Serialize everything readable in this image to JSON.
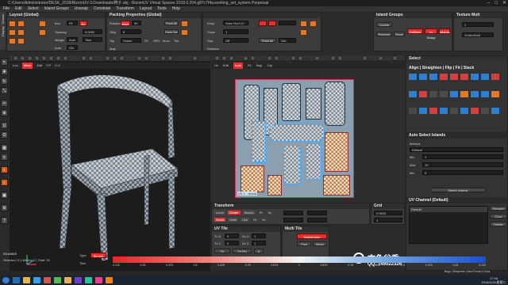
{
  "window": {
    "title": "C:/Users/Administrator/DESK_2018/RizomUV-3.Downloads/椅子.obj - RizomUV Virtual Spaces 2018.0.204.g87c7f4a.working_set_system Perpetual",
    "controls": [
      "–",
      "□",
      "✕"
    ]
  },
  "menu": [
    "File",
    "Edit",
    "Select",
    "Island Groups",
    "Unwrap",
    "Constrain",
    "Transform",
    "Layout",
    "Tools",
    "Help"
  ],
  "left_tab_labels": [
    "Seams",
    "Display"
  ],
  "panels": {
    "layout": {
      "title": "Layout (Global)",
      "labels": [
        "Box",
        "Spacing",
        "Margin",
        "Auto"
      ],
      "values": [
        "Fit",
        "Bo",
        "0.0052",
        "Auto",
        "Tiles",
        "1",
        "1",
        "ON"
      ]
    },
    "packing": {
      "title": "Packing Properties (Global)",
      "labels": [
        "Rotation",
        "Step",
        "Stp",
        "Map"
      ],
      "values": [
        "Mom",
        "90",
        "8",
        "Space",
        "Bo",
        "Opt"
      ],
      "checks": [
        "Fit",
        "SPD",
        "Mom",
        "Tile"
      ],
      "buttons": [
        "Pack All",
        "Pack Sel."
      ]
    },
    "keep": {
      "labels": [
        "Keep",
        "Scale",
        "Gap",
        "Rotation"
      ],
      "values": [
        "Spec Ro(4,2)",
        "1",
        "Off",
        "Opt"
      ],
      "buttons": [
        "Pack All"
      ]
    },
    "island_groups": {
      "title": "Island Groups",
      "buttons": [
        "Create",
        "Remove",
        "Outlines",
        "In Group",
        "Islands",
        "Show"
      ]
    },
    "texture": {
      "title": "Texture Mult",
      "values": [
        "1",
        "2048x2048"
      ]
    }
  },
  "viewport3d": {
    "label": "Lon",
    "tabs": [
      "Mesh",
      "Edit",
      "F.P",
      "C.S"
    ]
  },
  "uv_viewport": {
    "header_tabs": [
      "Uv",
      "Edit",
      "Auto",
      "Fit",
      "Swp",
      "Clip"
    ],
    "island_label": "UV 1 - Island"
  },
  "right_panel": {
    "title": "Select",
    "align_title": "Align | Straighten | Flip | Fit | Stack",
    "auto_select_title": "Auto Select Islands",
    "auto_labels": [
      "Method",
      "Min",
      "Max",
      "Min"
    ],
    "auto_values": [
      "Default",
      "1",
      "10",
      "0"
    ],
    "auto_button": "Select Islands",
    "uv_channel_title": "UV Channel (Default)",
    "uv_channel_value": "Default",
    "uv_channel_buttons": [
      "Rename",
      "Copy",
      "Delete"
    ]
  },
  "transform": {
    "title": "Transform",
    "row1": [
      "Local",
      "Center",
      "Mouse",
      "Rt",
      "Sc"
    ],
    "row2": [
      "World",
      "Multi",
      "Use",
      "Rt",
      "Sc"
    ],
    "grid_title": "Grid",
    "grid_values": [
      "0.0625",
      "1"
    ]
  },
  "uv_tile": {
    "title": "UV Tile",
    "labels": [
      "Tx U",
      "Tx V",
      "Sz U",
      "Sz V",
      "Fit",
      "Fit Pin",
      "A"
    ],
    "values": [
      "0",
      "0",
      "1",
      "1"
    ]
  },
  "multi_tile": {
    "title": "Multi Tile",
    "buttons": [
      "Switch/Auto",
      "Pick",
      "Move"
    ]
  },
  "status": {
    "mode": "ISLANDS",
    "selection": "Selected: 0 | Hidden: 0 | Total: 34",
    "type_label": "Type",
    "type_value": "Stretch",
    "tiles_label": "Tiles",
    "scale_ticks": [
      "0.125",
      "0.25",
      "0.375",
      "0.5",
      "0.625",
      "0.75",
      "0.875",
      "1",
      "0.875",
      "0.75",
      "0.625",
      "0.5",
      "0.375",
      "0.25",
      "0.125"
    ],
    "right_info": "Bugs | Requests | New Forum | Docs"
  },
  "watermark": {
    "cn": "古色谷香",
    "qq": "QQ: 745022326"
  },
  "taskbar": {
    "time": "17:46",
    "date": "2018/4/10/星期二"
  },
  "sidebar_icons": [
    "select-icon",
    "move-icon",
    "rotate-icon",
    "scale-icon",
    "cut-icon",
    "weld-icon",
    "unfold-icon",
    "optimize-icon",
    "pack-icon",
    "stack-icon",
    "symmetry-icon",
    "zoom-icon",
    "fit-icon",
    "settings-icon",
    "help-icon"
  ],
  "colors": {
    "accent_orange": "#e07a2a",
    "accent_red": "#d83030",
    "bg": "#2b2b2b",
    "uv_bg": "#8aa0b0"
  }
}
